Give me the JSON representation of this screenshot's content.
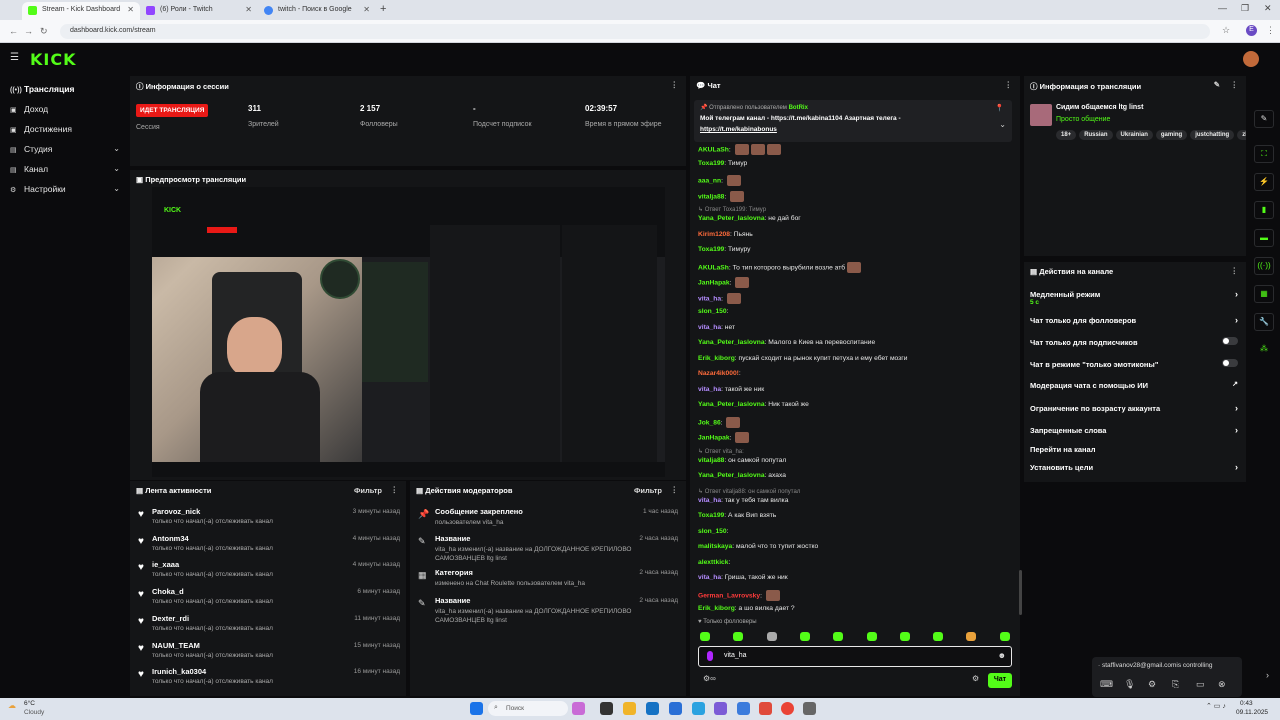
{
  "browser": {
    "tabs": [
      {
        "label": "Stream - Kick Dashboard",
        "active": true
      },
      {
        "label": "(6) Роли - Twitch",
        "active": false
      },
      {
        "label": "twitch - Поиск в Google",
        "active": false
      }
    ],
    "url": "dashboard.kick.com/stream",
    "profile_initial": "E"
  },
  "brand": {
    "logo": "KICK",
    "accent": "#53fc18"
  },
  "nav": [
    {
      "label": "Трансляция",
      "icon": "broadcast-icon",
      "active": true,
      "chevron": false
    },
    {
      "label": "Доход",
      "icon": "money-icon",
      "active": false,
      "chevron": false
    },
    {
      "label": "Достижения",
      "icon": "trophy-icon",
      "active": false,
      "chevron": false
    },
    {
      "label": "Студия",
      "icon": "studio-icon",
      "active": false,
      "chevron": true
    },
    {
      "label": "Канал",
      "icon": "channel-icon",
      "active": false,
      "chevron": true
    },
    {
      "label": "Настройки",
      "icon": "gear-icon",
      "active": false,
      "chevron": true
    }
  ],
  "session": {
    "title": "Информация о сессии",
    "live_badge": "ИДЕТ ТРАНСЛЯЦИЯ",
    "stats": [
      {
        "value": "",
        "label": "Сессия"
      },
      {
        "value": "311",
        "label": "Зрителей"
      },
      {
        "value": "2 157",
        "label": "Фолловеры"
      },
      {
        "value": "-",
        "label": "Подсчет подписок"
      },
      {
        "value": "02:39:57",
        "label": "Время в прямом эфире"
      }
    ]
  },
  "preview": {
    "title": "Предпросмотр трансляции"
  },
  "activity": {
    "title": "Лента активности",
    "filter": "Фильтр",
    "items": [
      {
        "name": "Parovoz_nick",
        "desc": "только что начал(-а) отслеживать канал",
        "time": "3 минуты назад"
      },
      {
        "name": "Antonm34",
        "desc": "только что начал(-а) отслеживать канал",
        "time": "4 минуты назад"
      },
      {
        "name": "ie_xaaa",
        "desc": "только что начал(-а) отслеживать канал",
        "time": "4 минуты назад"
      },
      {
        "name": "Choka_d",
        "desc": "только что начал(-а) отслеживать канал",
        "time": "6 минут назад"
      },
      {
        "name": "Dexter_rdi",
        "desc": "только что начал(-а) отслеживать канал",
        "time": "11 минут назад"
      },
      {
        "name": "NAUM_TEAM",
        "desc": "только что начал(-а) отслеживать канал",
        "time": "15 минут назад"
      },
      {
        "name": "Irunich_ka0304",
        "desc": "только что начал(-а) отслеживать канал",
        "time": "16 минут назад"
      }
    ]
  },
  "mods": {
    "title": "Действия модераторов",
    "filter": "Фильтр",
    "items": [
      {
        "icon": "pin-icon",
        "title": "Сообщение закреплено",
        "desc": "пользователем vita_ha",
        "time": "1 час назад"
      },
      {
        "icon": "edit-icon",
        "title": "Название",
        "desc": "vita_ha изменил(-а) название на ДОЛГОЖДАННОЕ КРЕПИЛОВО САМОЗВАНЦЕВ ltg linst",
        "time": "2 часа назад"
      },
      {
        "icon": "category-icon",
        "title": "Категория",
        "desc": "изменено на Chat Roulette пользователем vita_ha",
        "time": "2 часа назад"
      },
      {
        "icon": "edit-icon",
        "title": "Название",
        "desc": "vita_ha изменил(-а) название на ДОЛГОЖДАННОЕ КРЕПИЛОВО САМОЗВАНЦЕВ ltg linst",
        "time": "2 часа назад"
      }
    ]
  },
  "chat": {
    "title": "Чат",
    "pinned_by": "Отправлено пользователем",
    "pinned_user": "BotRix",
    "pinned_text": "Мой телеграм канал - https://t.me/kabina1104 Азартная телега -",
    "pinned_link2": "https://t.me/kabinabonus",
    "messages": [
      {
        "user": "AKULaSh",
        "color": "#53fc18",
        "text": "",
        "emotes": 3
      },
      {
        "user": "Toxa199",
        "color": "#53fc18",
        "text": "Тимур",
        "emotes": 0
      },
      {
        "user": "aaa_nn",
        "color": "#53fc18",
        "text": "",
        "emotes": 1
      },
      {
        "user": "vitalja88",
        "color": "#53fc18",
        "text": "",
        "emotes": 1
      },
      {
        "user": "Yana_Peter_laslovna",
        "color": "#53fc18",
        "text": "не дай бог",
        "emotes": 0,
        "reply": "Ответ Toxa199: Тимур"
      },
      {
        "user": "Kirim1208",
        "color": "#ff6b3b",
        "text": "Пьянь",
        "emotes": 0
      },
      {
        "user": "Toxa199",
        "color": "#53fc18",
        "text": "Тимуру",
        "emotes": 0
      },
      {
        "user": "AKULaSh",
        "color": "#53fc18",
        "text": "То тип которого вырубили возле атб",
        "emotes": 1
      },
      {
        "user": "JanHapak",
        "color": "#53fc18",
        "text": "",
        "emotes": 1
      },
      {
        "user": "vita_ha",
        "color": "#b48cff",
        "text": "",
        "emotes": 1
      },
      {
        "user": "slon_150",
        "color": "#53fc18",
        "text": "",
        "emotes": 0
      },
      {
        "user": "vita_ha",
        "color": "#b48cff",
        "text": "нет",
        "emotes": 0
      },
      {
        "user": "Yana_Peter_laslovna",
        "color": "#53fc18",
        "text": "Малого в Киев на перевоспитание",
        "emotes": 0
      },
      {
        "user": "Erik_kiborg",
        "color": "#53fc18",
        "text": "пускай сходит на рынок купит петуха и ему ебет мозги",
        "emotes": 0
      },
      {
        "user": "Nazar4ik000!",
        "color": "#ff6b3b",
        "text": "",
        "emotes": 0
      },
      {
        "user": "vita_ha",
        "color": "#b48cff",
        "text": "такой же ник",
        "emotes": 0
      },
      {
        "user": "Yana_Peter_laslovna",
        "color": "#53fc18",
        "text": "Ник такой же",
        "emotes": 0
      },
      {
        "user": "Jok_86",
        "color": "#53fc18",
        "text": "",
        "emotes": 1
      },
      {
        "user": "JanHapak",
        "color": "#53fc18",
        "text": "",
        "emotes": 1
      },
      {
        "user": "vitalja88",
        "color": "#53fc18",
        "text": "он самкой попутал",
        "emotes": 0,
        "reply": "Ответ vita_ha:"
      },
      {
        "user": "Yana_Peter_laslovna",
        "color": "#53fc18",
        "text": "ахаха",
        "emotes": 0
      },
      {
        "user": "vita_ha",
        "color": "#b48cff",
        "text": "так у тебя там вилка",
        "emotes": 0,
        "reply": "Ответ vitalja88: он самкой попутал"
      },
      {
        "user": "Toxa199",
        "color": "#53fc18",
        "text": "А как Вип взять",
        "emotes": 0
      },
      {
        "user": "slon_150",
        "color": "#53fc18",
        "text": "",
        "emotes": 0
      },
      {
        "user": "malitskaya",
        "color": "#53fc18",
        "text": "малой что то тупит жостко",
        "emotes": 0
      },
      {
        "user": "alexttkick",
        "color": "#53fc18",
        "text": "",
        "emotes": 0
      },
      {
        "user": "vita_ha",
        "color": "#b48cff",
        "text": "Гриша, такой же ник",
        "emotes": 0
      },
      {
        "user": "German_Lavrovsky",
        "color": "#ff3b3b",
        "text": "",
        "emotes": 1
      },
      {
        "user": "Erik_kiborg",
        "color": "#53fc18",
        "text": "а шо вилка дает ?",
        "emotes": 0
      }
    ],
    "followers_only": "Только фолловеры",
    "input_value": "vita_ha",
    "send_label": "Чат"
  },
  "stream_info": {
    "title": "Информация о трансляции",
    "stream_title": "Сидим общаемся ltg linst",
    "category": "Просто общение",
    "tags": [
      "18+",
      "Russian",
      "Ukrainian",
      "gaming",
      "justchatting",
      "zh"
    ]
  },
  "channel_actions": {
    "title": "Действия на канале",
    "slow_mode_sub": "5 с",
    "items": [
      {
        "label": "Медленный режим",
        "control": "chevron"
      },
      {
        "label": "Чат только для фолловеров",
        "control": "chevron"
      },
      {
        "label": "Чат только для подписчиков",
        "control": "toggle"
      },
      {
        "label": "Чат в режиме \"только эмотиконы\"",
        "control": "toggle"
      },
      {
        "label": "Модерация чата с помощью ИИ",
        "control": "external"
      },
      {
        "label": "Ограничение по возрасту аккаунта",
        "control": "chevron"
      },
      {
        "label": "Запрещенные слова",
        "control": "chevron"
      },
      {
        "label": "Перейти на канал",
        "control": "none"
      },
      {
        "label": "Установить цели",
        "control": "chevron"
      }
    ]
  },
  "toast": {
    "text": "staffivanov28@gmail.comis controlling"
  },
  "taskbar": {
    "weather_temp": "6°C",
    "weather_desc": "Cloudy",
    "search": "Поиск",
    "time": "0:43",
    "date": "09.11.2025"
  }
}
